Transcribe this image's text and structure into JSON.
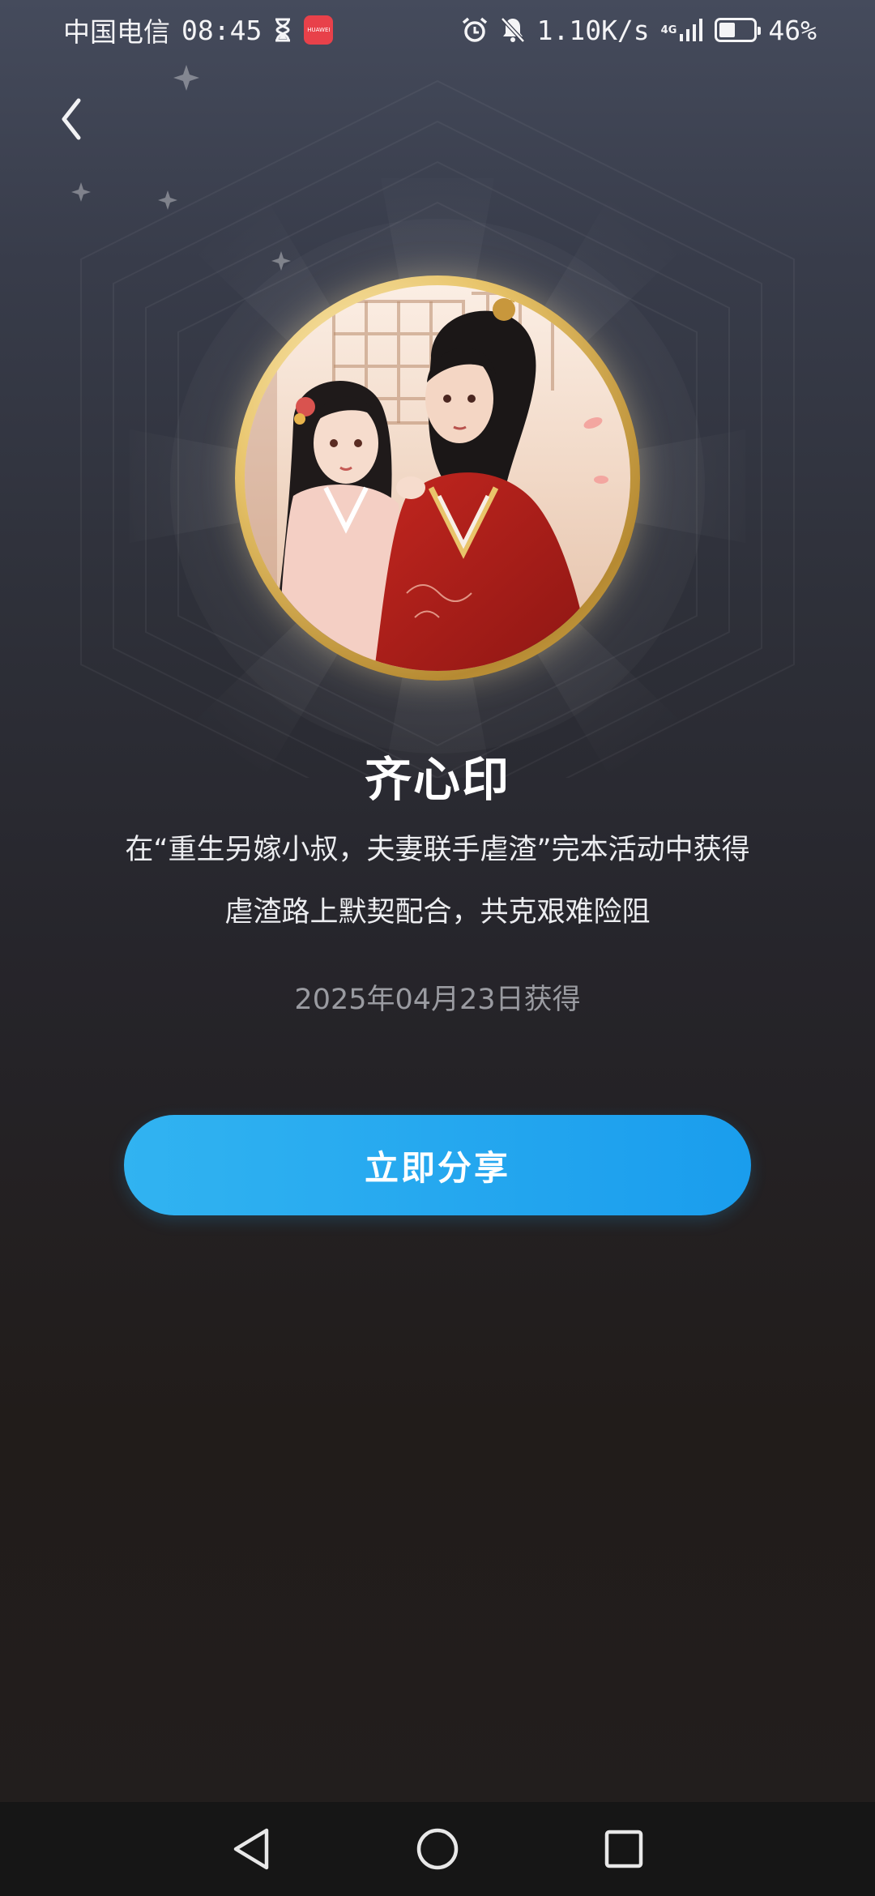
{
  "status_bar": {
    "carrier": "中国电信",
    "time": "08:45",
    "app_badge_text": "HUAWEI",
    "net_speed": "1.10K/s",
    "network_type": "4G",
    "battery": "46%",
    "battery_level": 0.46,
    "icons": [
      "hourglass-icon",
      "alarm-icon",
      "bell-muted-icon",
      "signal-icon",
      "battery-icon"
    ]
  },
  "header": {
    "back_icon": "chevron-left-icon"
  },
  "badge": {
    "title": "齐心印",
    "description_line1": "在“重生另嫁小叔，夫妻联手虐渣”完本活动中获得",
    "description_line2": "虐渣路上默契配合，共克艰难险阻",
    "date": "2025年04月23日获得",
    "ring_color": "#d9b45a"
  },
  "actions": {
    "share_label": "立即分享",
    "share_color": "#25a8ef"
  },
  "nav_bar": {
    "icons": [
      "back-triangle-icon",
      "home-circle-icon",
      "recents-square-icon"
    ]
  }
}
